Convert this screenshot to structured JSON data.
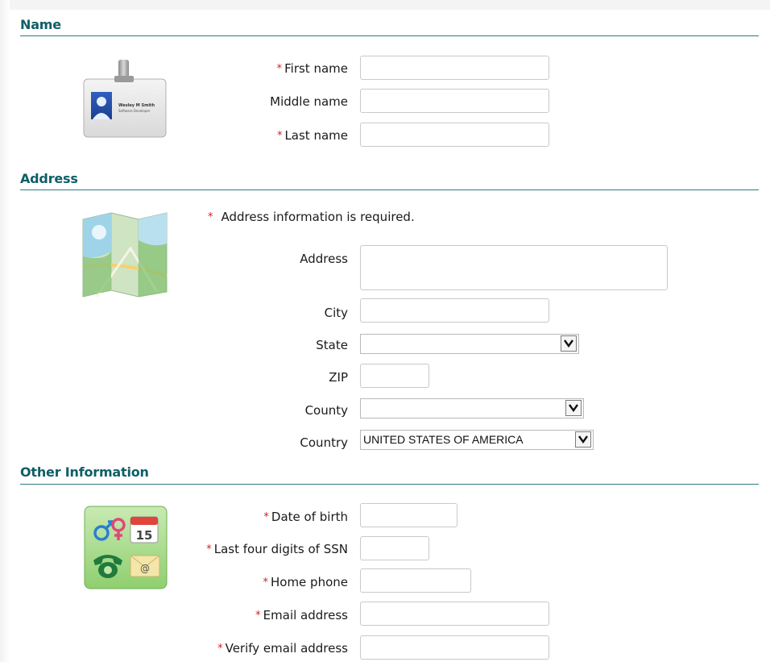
{
  "sections": {
    "name": {
      "title": "Name",
      "first_name": {
        "label": "First name",
        "value": ""
      },
      "middle_name": {
        "label": "Middle name",
        "value": ""
      },
      "last_name": {
        "label": "Last name",
        "value": ""
      },
      "badge": {
        "person_name": "Wesley M Smith",
        "person_title": "Software Developer"
      }
    },
    "address": {
      "title": "Address",
      "required_note": "Address information is required.",
      "address": {
        "label": "Address",
        "value": ""
      },
      "city": {
        "label": "City",
        "value": ""
      },
      "state": {
        "label": "State",
        "value": ""
      },
      "zip": {
        "label": "ZIP",
        "value": ""
      },
      "county": {
        "label": "County",
        "value": ""
      },
      "country": {
        "label": "Country",
        "value": "UNITED STATES OF AMERICA"
      }
    },
    "other": {
      "title": "Other Information",
      "dob": {
        "label": "Date of birth",
        "value": ""
      },
      "ssn4": {
        "label": "Last four digits of SSN",
        "value": ""
      },
      "home_phone": {
        "label": "Home phone",
        "value": ""
      },
      "email": {
        "label": "Email address",
        "value": ""
      },
      "verify_email": {
        "label": "Verify email address",
        "value": ""
      },
      "calendar_day": "15"
    }
  },
  "required_marker": "*",
  "icons": [
    "id-badge-icon",
    "map-icon",
    "contact-info-icon",
    "dropdown-arrow-icon"
  ],
  "colors": {
    "section_title": "#0e5f66",
    "rule": "#2f7a80",
    "required": "#d21f1f"
  }
}
